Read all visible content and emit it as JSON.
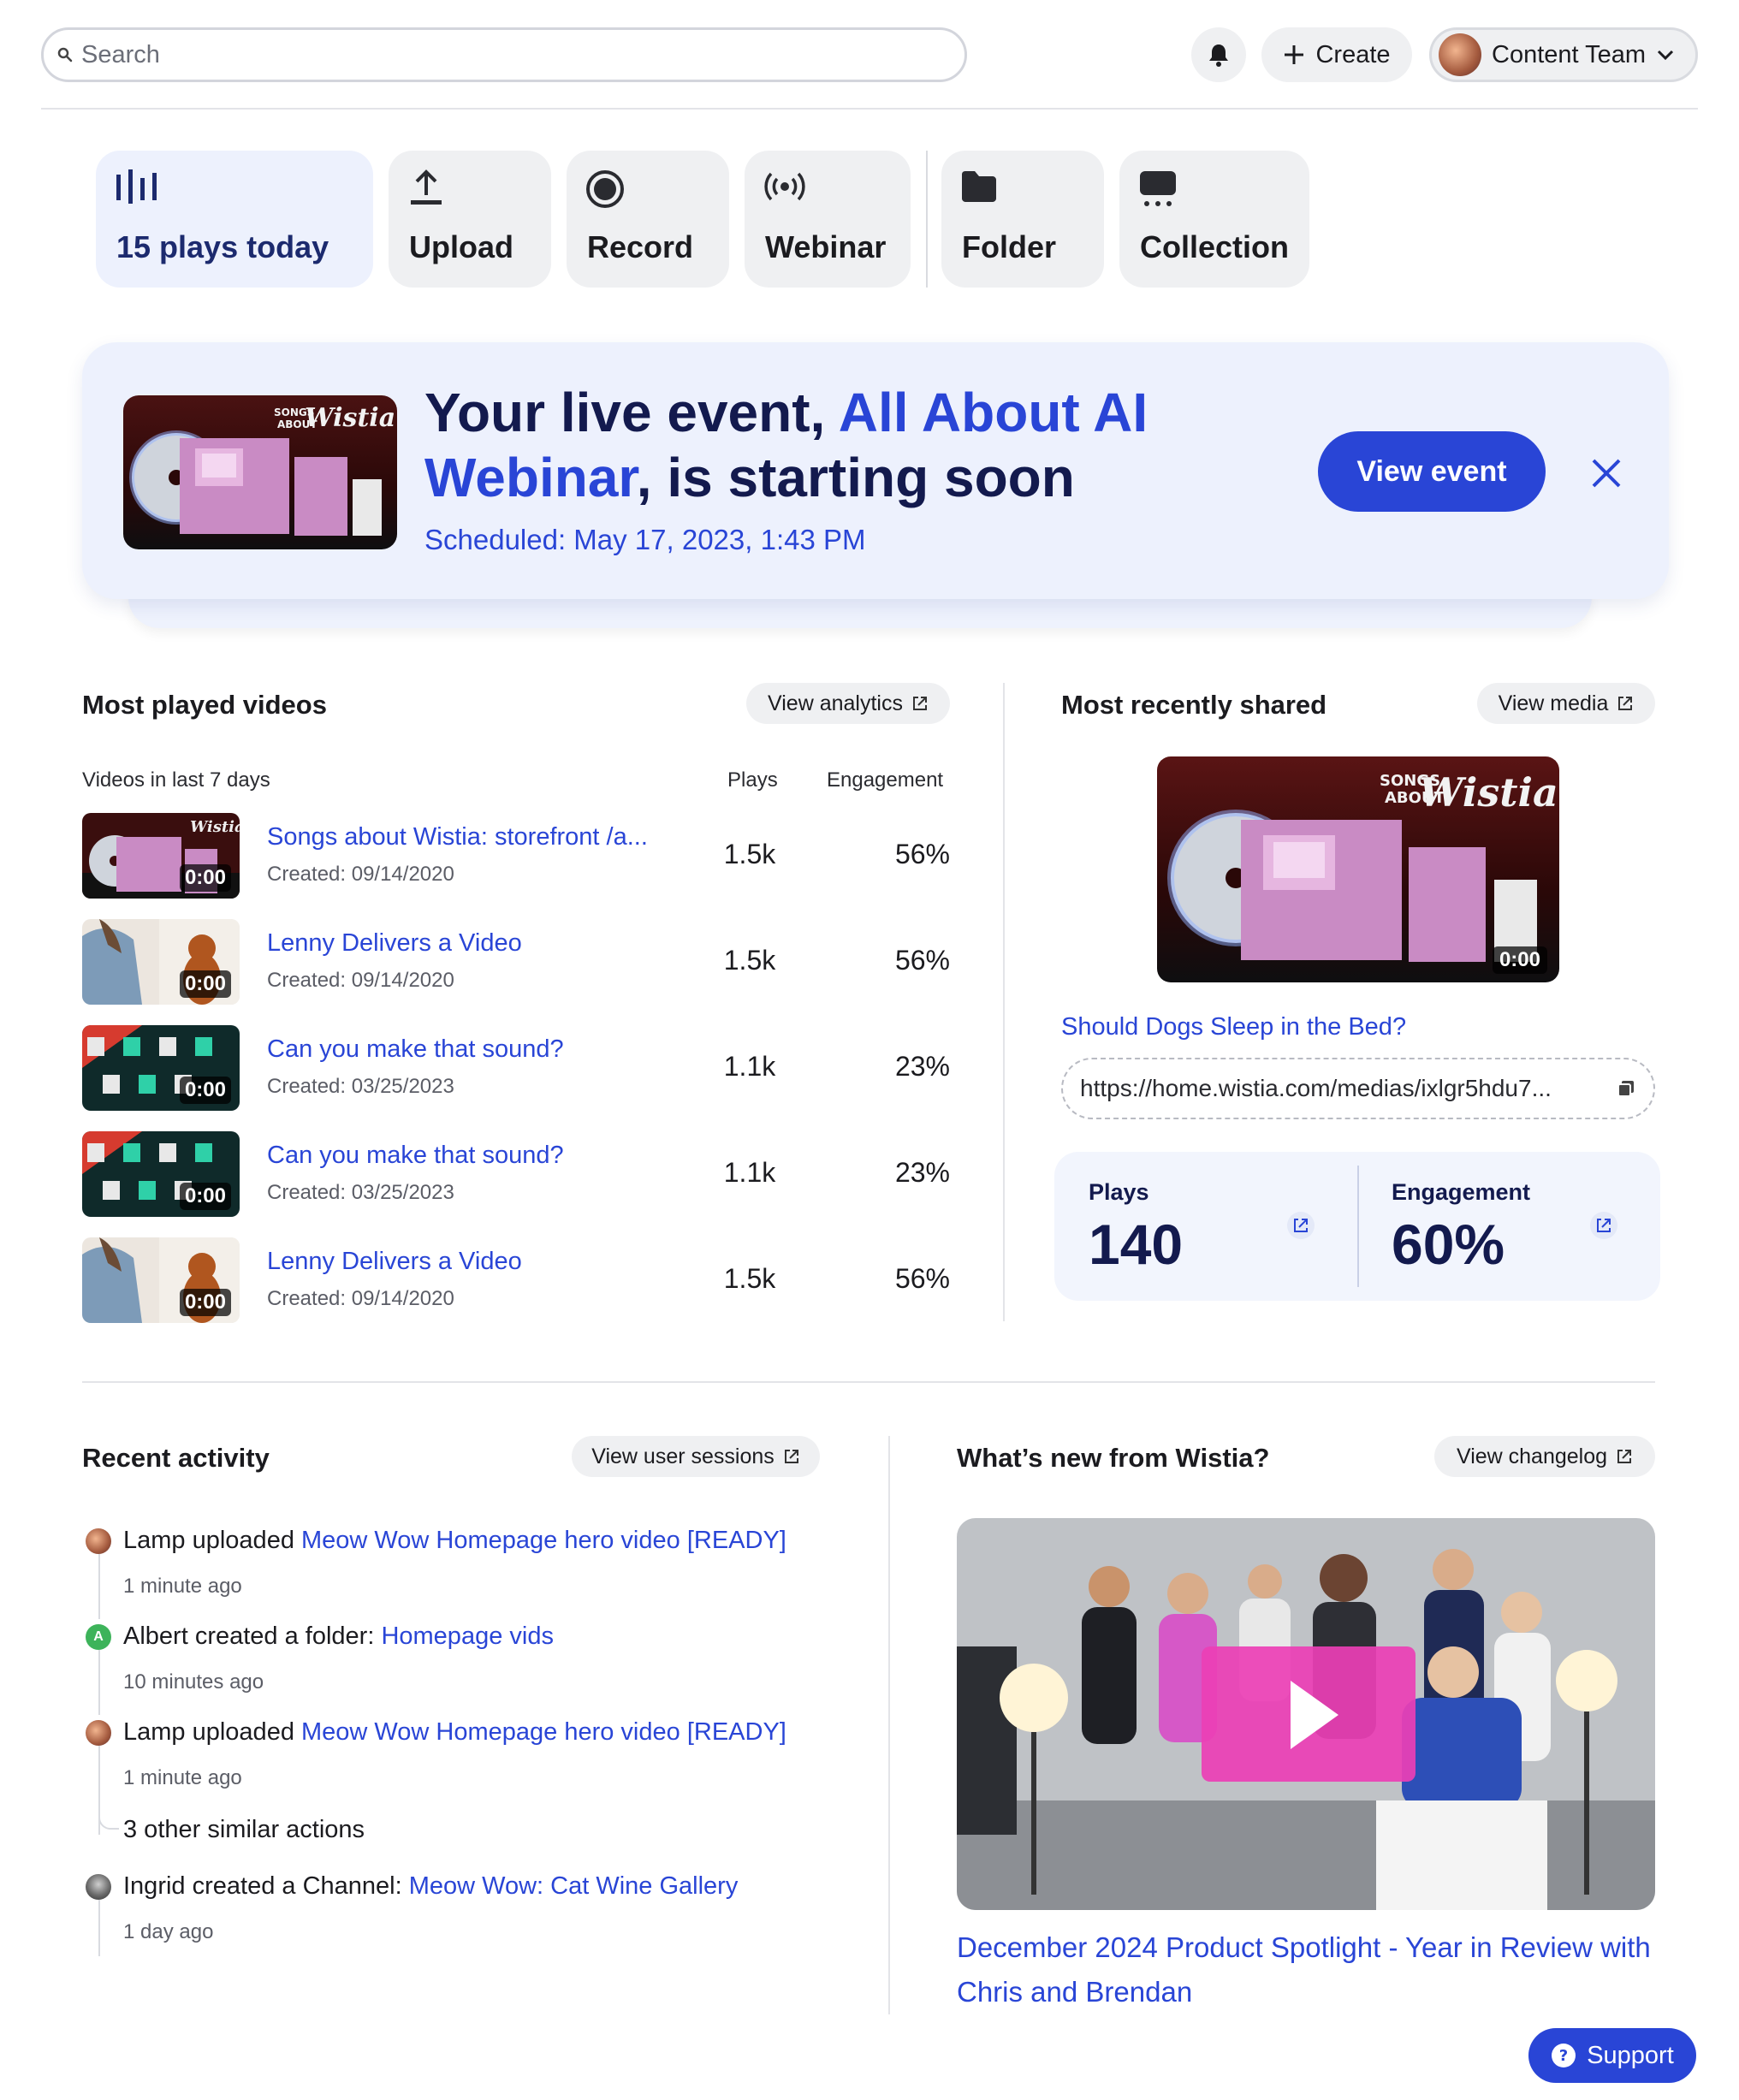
{
  "topbar": {
    "search_placeholder": "Search",
    "create_label": "Create",
    "account_label": "Content Team"
  },
  "quick_actions": [
    {
      "label": "15 plays today",
      "icon": "bars-icon",
      "highlighted": true
    },
    {
      "label": "Upload",
      "icon": "upload-icon"
    },
    {
      "label": "Record",
      "icon": "record-icon"
    },
    {
      "label": "Webinar",
      "icon": "broadcast-icon"
    },
    {
      "label": "Folder",
      "icon": "folder-icon"
    },
    {
      "label": "Collection",
      "icon": "collection-icon"
    }
  ],
  "banner": {
    "title_prefix": "Your live event, ",
    "event_name": "All About AI Webinar",
    "title_suffix": ", is starting soon",
    "scheduled": "Scheduled: May 17, 2023, 1:43 PM",
    "button_label": "View event"
  },
  "most_played": {
    "heading": "Most played videos",
    "button_label": "View analytics",
    "col_videos": "Videos in last 7 days",
    "col_plays": "Plays",
    "col_engagement": "Engagement",
    "rows": [
      {
        "title": "Songs about Wistia: storefront /a...",
        "created": "Created: 09/14/2020",
        "plays": "1.5k",
        "engagement": "56%",
        "duration": "0:00",
        "thumb": "album"
      },
      {
        "title": "Lenny Delivers a Video",
        "created": "Created: 09/14/2020",
        "plays": "1.5k",
        "engagement": "56%",
        "duration": "0:00",
        "thumb": "dog"
      },
      {
        "title": "Can you make that sound?",
        "created": "Created: 03/25/2023",
        "plays": "1.1k",
        "engagement": "23%",
        "duration": "0:00",
        "thumb": "sound"
      },
      {
        "title": "Can you make that sound?",
        "created": "Created: 03/25/2023",
        "plays": "1.1k",
        "engagement": "23%",
        "duration": "0:00",
        "thumb": "sound"
      },
      {
        "title": "Lenny Delivers a Video",
        "created": "Created: 09/14/2020",
        "plays": "1.5k",
        "engagement": "56%",
        "duration": "0:00",
        "thumb": "dog"
      }
    ]
  },
  "recent_shared": {
    "heading": "Most recently shared",
    "button_label": "View media",
    "duration": "0:00",
    "title": "Should Dogs Sleep in the Bed?",
    "url": "https://home.wistia.com/medias/ixlgr5hdu7...",
    "plays_label": "Plays",
    "plays_value": "140",
    "engagement_label": "Engagement",
    "engagement_value": "60%"
  },
  "activity": {
    "heading": "Recent activity",
    "button_label": "View user sessions",
    "items": [
      {
        "actor": "Lamp",
        "action": " uploaded ",
        "target": "Meow Wow Homepage hero video [READY]",
        "time": "1 minute ago"
      },
      {
        "actor": "Albert",
        "action": " created a folder: ",
        "target": "Homepage vids",
        "time": "10 minutes ago",
        "avatar_letter": "A"
      },
      {
        "actor": "Lamp",
        "action": " uploaded ",
        "target": "Meow Wow Homepage hero video [READY]",
        "time": "1 minute ago"
      },
      {
        "actor": "Ingrid",
        "action": " created a Channel: ",
        "target": "Meow Wow: Cat Wine Gallery",
        "time": "1 day ago"
      }
    ],
    "similar_actions": "3 other similar actions"
  },
  "whats_new": {
    "heading": "What’s new from Wistia?",
    "button_label": "View changelog",
    "title": "December 2024 Product Spotlight - Year in Review with Chris and Brendan"
  },
  "support_label": "Support",
  "colors": {
    "accent": "#2945d6",
    "navy": "#131a4e",
    "banner_bg": "#edf1fd",
    "pink_play": "#ec3fb5"
  }
}
